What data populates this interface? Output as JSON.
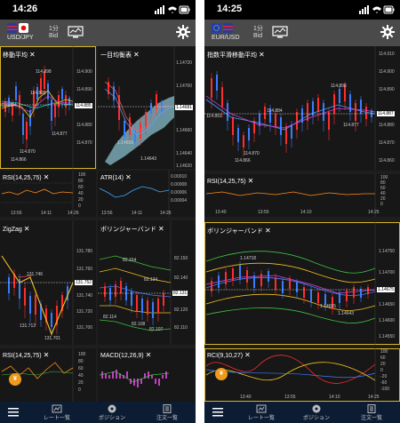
{
  "colors": {
    "selected_border": "#d8b429",
    "bull": "#ff2d2d",
    "bear": "#3b7cff",
    "header_bg": "#4a4a4a",
    "tabbar_bg": "#0c1c33",
    "fab": "#f09a1c"
  },
  "left": {
    "status": {
      "time": "14:26"
    },
    "header": {
      "pair": "USD/JPY",
      "tf_top": "1分",
      "tf_bottom": "Bid"
    },
    "panels": {
      "sma": {
        "title": "移動平均",
        "prices": [
          "114.898",
          "114.889",
          "114.884",
          "114.877",
          "114.870",
          "114.866"
        ],
        "axis": [
          "114.900",
          "114.890",
          "114.880",
          "114.870"
        ],
        "current": "114.885"
      },
      "ichimoku": {
        "title": "一目均衡表",
        "prices": [
          "1.14659",
          "1.14643"
        ],
        "axis": [
          "1.14720",
          "1.14700",
          "1.14660",
          "1.14640",
          "1.14620"
        ],
        "current": "1.14681"
      },
      "rsi": {
        "title": "RSI(14,25,75)",
        "axis": [
          "100",
          "80",
          "60",
          "40",
          "20",
          "0"
        ],
        "times": [
          "13:56",
          "14:11",
          "14:26"
        ]
      },
      "atr": {
        "title": "ATR(14)",
        "axis": [
          "0.00010",
          "0.00008",
          "0.00006",
          "0.00004"
        ],
        "times": [
          "13:56",
          "14:11",
          "14:26"
        ]
      },
      "zigzag": {
        "title": "ZigZag",
        "prices": [
          "131.746",
          "131.713",
          "131.701"
        ],
        "axis": [
          "131.780",
          "131.760",
          "131.740",
          "131.720",
          "131.700"
        ],
        "current": "131.752"
      },
      "bollinger": {
        "title": "ボリンジャーバンド",
        "prices": [
          "82.154",
          "82.134",
          "82.114",
          "82.108",
          "82.107"
        ],
        "axis": [
          "82.150",
          "82.140",
          "82.120",
          "82.110"
        ],
        "current": "82.131"
      },
      "rsi2": {
        "title": "RSI(14,25,75)",
        "axis": [
          "100",
          "80",
          "60",
          "40",
          "20",
          "0"
        ]
      },
      "macd": {
        "title": "MACD(12,26,9)"
      }
    },
    "tabbar": {
      "menu": "menu-icon",
      "rates": "レート一覧",
      "positions": "ポジション",
      "orders": "注文一覧"
    }
  },
  "right": {
    "status": {
      "time": "14:25"
    },
    "header": {
      "pair": "EUR/USD",
      "tf_top": "1分",
      "tf_bottom": "Bid"
    },
    "panels": {
      "ema": {
        "title": "指数平滑移動平均",
        "prices": [
          "114.898",
          "114.891",
          "114.884",
          "114.877",
          "114.870",
          "114.866"
        ],
        "axis": [
          "114.910",
          "114.900",
          "114.890",
          "114.880",
          "114.870",
          "114.860"
        ],
        "current": "114.887"
      },
      "rsi": {
        "title": "RSI(14,25,75)",
        "axis": [
          "100",
          "80",
          "60",
          "40",
          "20",
          "0"
        ],
        "times": [
          "13:40",
          "13:55",
          "14:10",
          "14:25"
        ]
      },
      "bollinger": {
        "title": "ボリンジャーバンド",
        "prices": [
          "1.14718",
          "1.14655",
          "1.14643"
        ],
        "axis": [
          "1.14750",
          "1.14700",
          "1.14650",
          "1.14600",
          "1.14550"
        ],
        "current": "1.14675"
      },
      "rci": {
        "title": "RCI(9,10,27)",
        "axis": [
          "100",
          "80",
          "60",
          "40",
          "20",
          "0",
          "-20",
          "-40",
          "-60",
          "-80",
          "-100"
        ],
        "times": [
          "13:40",
          "13:55",
          "14:10",
          "14:25"
        ]
      }
    },
    "tabbar": {
      "menu": "menu-icon",
      "rates": "レート一覧",
      "positions": "ポジション",
      "orders": "注文一覧"
    }
  }
}
